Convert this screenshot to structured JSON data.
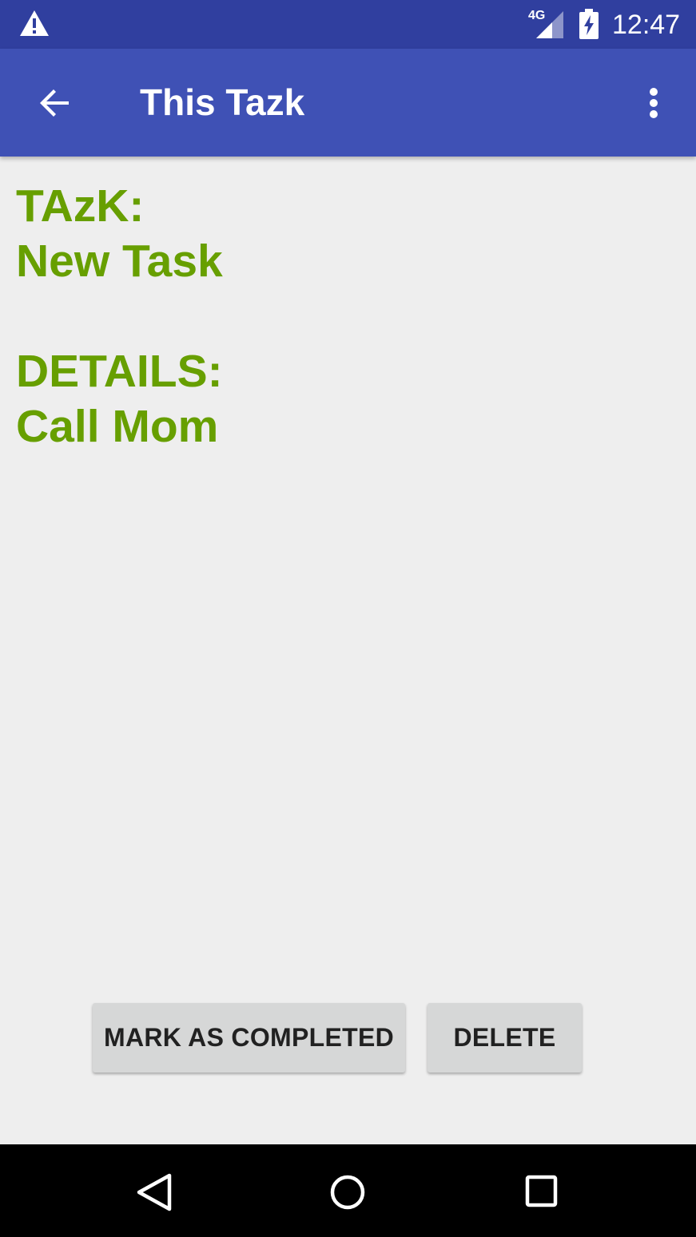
{
  "status_bar": {
    "time": "12:47",
    "network_label": "4G",
    "icons": [
      "warning-icon",
      "signal-icon",
      "battery-charging-icon"
    ]
  },
  "app_bar": {
    "title": "This Tazk",
    "back_icon": "arrow-back-icon",
    "overflow_icon": "more-vert-icon"
  },
  "task": {
    "task_label": "TAzK:",
    "task_value": "New Task",
    "details_label": "DETAILS:",
    "details_value": "Call Mom"
  },
  "actions": {
    "complete_label": "MARK AS COMPLETED",
    "delete_label": "DELETE"
  },
  "nav_bar": {
    "icons": [
      "nav-back-icon",
      "nav-home-icon",
      "nav-recents-icon"
    ]
  },
  "colors": {
    "status_bar": "#303f9f",
    "app_bar": "#3f51b5",
    "task_text": "#679f00",
    "background": "#eeeeee",
    "button": "#d6d7d7"
  }
}
